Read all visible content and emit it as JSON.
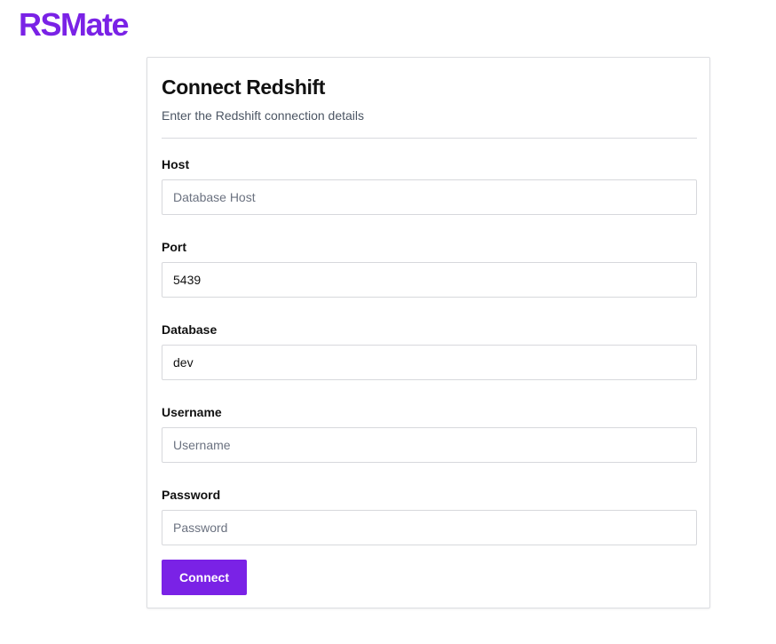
{
  "app": {
    "logo": "RSMate"
  },
  "colors": {
    "brand": "#7a22e6",
    "subtitle_text": "#4b5563",
    "placeholder_text": "#6b7280",
    "border": "#d7d8dc"
  },
  "form": {
    "title": "Connect Redshift",
    "subtitle": "Enter the Redshift connection details",
    "fields": {
      "host": {
        "label": "Host",
        "value": "",
        "placeholder": "Database Host"
      },
      "port": {
        "label": "Port",
        "value": "5439",
        "placeholder": ""
      },
      "database": {
        "label": "Database",
        "value": "dev",
        "placeholder": ""
      },
      "username": {
        "label": "Username",
        "value": "",
        "placeholder": "Username"
      },
      "password": {
        "label": "Password",
        "value": "",
        "placeholder": "Password"
      }
    },
    "submit_label": "Connect"
  }
}
